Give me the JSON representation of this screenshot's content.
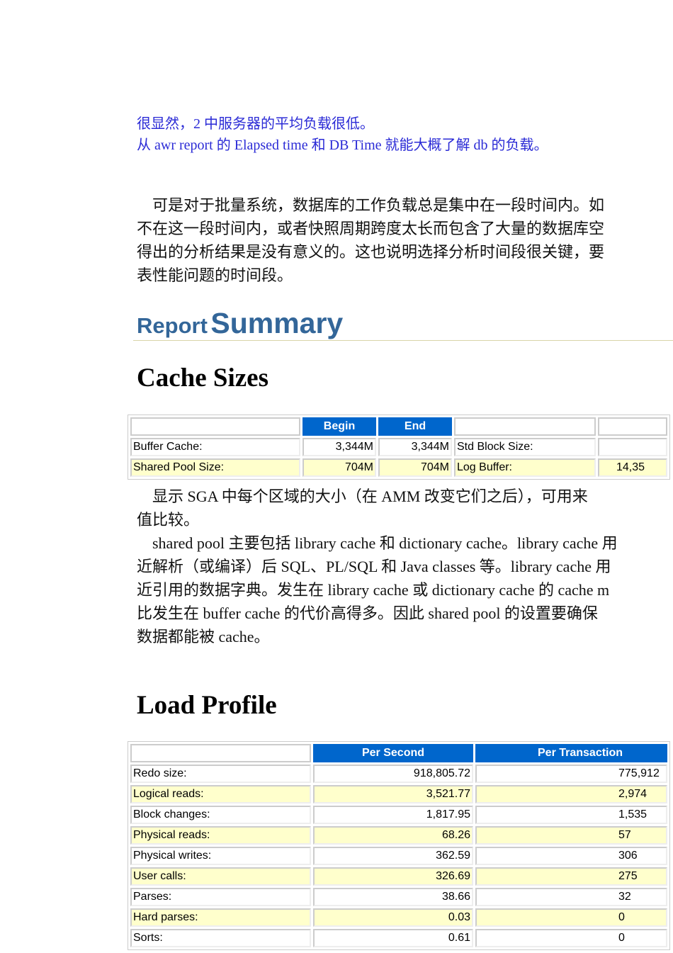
{
  "intro": {
    "blue_lines": [
      "很显然，2 中服务器的平均负载很低。",
      "从 awr report 的 Elapsed time 和 DB Time 就能大概了解 db 的负载。"
    ],
    "para_lines": [
      "　可是对于批量系统，数据库的工作负载总是集中在一段时间内。如",
      "不在这一段时间内，或者快照周期跨度太长而包含了大量的数据库空",
      "得出的分析结果是没有意义的。这也说明选择分析时间段很关键，要",
      "表性能问题的时间段。"
    ]
  },
  "report_summary": {
    "title_a": "Report",
    "title_b": "Summary"
  },
  "cache_sizes": {
    "title": "Cache Sizes",
    "headers": [
      "",
      "Begin",
      "End",
      "",
      ""
    ],
    "rows": [
      [
        "Buffer Cache:",
        "3,344M",
        "3,344M",
        "Std Block Size:",
        ""
      ],
      [
        "Shared Pool Size:",
        "704M",
        "704M",
        "Log Buffer:",
        "14,35"
      ]
    ],
    "para_lines": [
      "　显示 SGA 中每个区域的大小（在 AMM 改变它们之后），可用来",
      "值比较。",
      "　shared pool 主要包括 library cache 和 dictionary cache。library cache 用",
      "近解析（或编译）后 SQL、PL/SQL 和 Java classes 等。library cache 用",
      "近引用的数据字典。发生在 library cache 或 dictionary cache 的 cache m",
      "比发生在 buffer cache 的代价高得多。因此 shared pool 的设置要确保",
      "数据都能被 cache。"
    ]
  },
  "load_profile": {
    "title": "Load Profile",
    "headers": [
      "",
      "Per Second",
      "Per Transaction"
    ],
    "rows": [
      [
        "Redo size:",
        "918,805.72",
        "775,912"
      ],
      [
        "Logical reads:",
        "3,521.77",
        "2,974"
      ],
      [
        "Block changes:",
        "1,817.95",
        "1,535"
      ],
      [
        "Physical reads:",
        "68.26",
        "57"
      ],
      [
        "Physical writes:",
        "362.59",
        "306"
      ],
      [
        "User calls:",
        "326.69",
        "275"
      ],
      [
        "Parses:",
        "38.66",
        "32"
      ],
      [
        "Hard parses:",
        "0.03",
        "0"
      ],
      [
        "Sorts:",
        "0.61",
        "0"
      ]
    ]
  }
}
